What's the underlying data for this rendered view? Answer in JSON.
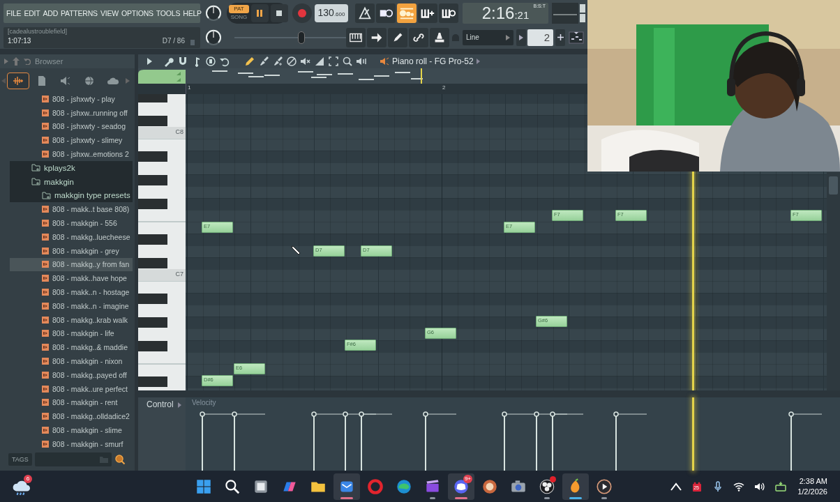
{
  "menu": [
    "FILE",
    "EDIT",
    "ADD",
    "PATTERNS",
    "VIEW",
    "OPTIONS",
    "TOOLS",
    "HELP"
  ],
  "transport": {
    "modes": [
      {
        "label": "PAT",
        "selected": true
      },
      {
        "label": "SONG",
        "selected": false
      }
    ],
    "playing": true,
    "tempo": "130",
    "tempo_fraction": ".600",
    "time": "2:16",
    "time_seconds": ":21",
    "time_format": "B:S:T"
  },
  "hint_bar": {
    "title": "[cadealustroublefield]",
    "time": "1:07:13",
    "note": "D7 / 86"
  },
  "pitch_slider": {
    "level": 0.6
  },
  "snap": {
    "value": "Line"
  },
  "step": {
    "value": "2"
  },
  "browser": {
    "title": "Browser",
    "tabs": [
      {
        "selected": true
      },
      {
        "selected": false
      },
      {
        "selected": false
      },
      {
        "selected": false
      },
      {
        "selected": false
      }
    ],
    "items": [
      {
        "kind": "preset",
        "label": "808 - jshxwty - play",
        "selected": false
      },
      {
        "kind": "preset",
        "label": "808 - jshxw..running off",
        "selected": false
      },
      {
        "kind": "preset",
        "label": "808 - jshxwty - seadog",
        "selected": false
      },
      {
        "kind": "preset",
        "label": "808 - jshxwty - slimey",
        "selected": false
      },
      {
        "kind": "preset",
        "label": "808 - jshxw..emotions 2",
        "selected": false
      },
      {
        "kind": "folder",
        "label": "kplays2k",
        "selected": false
      },
      {
        "kind": "folder",
        "label": "makkgin",
        "selected": false,
        "children": [
          {
            "kind": "folder",
            "label": "makkgin type presets",
            "selected": false,
            "children": [
              {
                "kind": "preset",
                "label": "808 - makk..t base 808)",
                "selected": false
              },
              {
                "kind": "preset",
                "label": "808 - makkgin - 556",
                "selected": false
              },
              {
                "kind": "preset",
                "label": "808 - makkg..luecheese",
                "selected": false
              },
              {
                "kind": "preset",
                "label": "808 - makkgin - grey",
                "selected": false
              },
              {
                "kind": "preset",
                "label": "808 - makkg..y from fan",
                "selected": true
              },
              {
                "kind": "preset",
                "label": "808 - makk..have hope",
                "selected": false
              },
              {
                "kind": "preset",
                "label": "808 - makk..n - hostage",
                "selected": false
              },
              {
                "kind": "preset",
                "label": "808 - makk..n - imagine",
                "selected": false
              },
              {
                "kind": "preset",
                "label": "808 - makkg..krab walk",
                "selected": false
              },
              {
                "kind": "preset",
                "label": "808 - makkgin - life",
                "selected": false
              },
              {
                "kind": "preset",
                "label": "808 - makkg..& maddie",
                "selected": false
              },
              {
                "kind": "preset",
                "label": "808 - makkgin - nixon",
                "selected": false
              },
              {
                "kind": "preset",
                "label": "808 - makkg..payed off",
                "selected": false
              },
              {
                "kind": "preset",
                "label": "808 - makk..ure perfect",
                "selected": false
              },
              {
                "kind": "preset",
                "label": "808 - makkgin - rent",
                "selected": false
              },
              {
                "kind": "preset",
                "label": "808 - makkg..olldadice2",
                "selected": false
              },
              {
                "kind": "preset",
                "label": "808 - makkgin - slime",
                "selected": false
              },
              {
                "kind": "preset",
                "label": "808 - makkgin - smurf",
                "selected": false
              }
            ]
          }
        ]
      }
    ],
    "tags_label": "TAGS"
  },
  "piano_roll": {
    "title": "Piano roll - FG Pro-52",
    "tools": [
      {
        "selected": true
      },
      {
        "selected": false
      },
      {
        "selected": false
      },
      {
        "selected": false
      },
      {
        "selected": false
      },
      {
        "selected": false
      },
      {
        "selected": false
      },
      {
        "selected": false
      },
      {
        "selected": false
      }
    ],
    "ruler": [
      "1",
      "2"
    ],
    "keys": [
      "C8",
      "C7"
    ],
    "notes": [
      {
        "label": "E7"
      },
      {
        "label": "D#6"
      },
      {
        "label": "E6"
      },
      {
        "label": "D7"
      },
      {
        "label": "F#6"
      },
      {
        "label": "D7"
      },
      {
        "label": "G6"
      },
      {
        "label": "E7"
      },
      {
        "label": "G#6"
      },
      {
        "label": "F7"
      },
      {
        "label": "F7"
      },
      {
        "label": "F7"
      }
    ],
    "control_label": "Control",
    "control_target": "Velocity"
  },
  "taskbar": {
    "apps": [
      {
        "kind": "weather",
        "selected": false,
        "running": false,
        "badge": "6"
      },
      {
        "kind": "start",
        "selected": false,
        "running": false
      },
      {
        "kind": "search",
        "selected": false,
        "running": false
      },
      {
        "kind": "files",
        "selected": false,
        "running": false
      },
      {
        "kind": "copilot",
        "selected": false,
        "running": false
      },
      {
        "kind": "explorer",
        "selected": false,
        "running": false
      },
      {
        "kind": "mail",
        "selected": true,
        "running": true
      },
      {
        "kind": "opera",
        "selected": false,
        "running": false
      },
      {
        "kind": "edge",
        "selected": false,
        "running": false
      },
      {
        "kind": "clapper",
        "selected": false,
        "running": true
      },
      {
        "kind": "discord",
        "selected": true,
        "running": true,
        "badge": "9+"
      },
      {
        "kind": "paint",
        "selected": false,
        "running": false
      },
      {
        "kind": "camera",
        "selected": false,
        "running": false
      },
      {
        "kind": "obs",
        "selected": false,
        "running": true,
        "alert": true
      },
      {
        "kind": "fl",
        "selected": true,
        "running": true
      },
      {
        "kind": "player",
        "selected": false,
        "running": true
      }
    ],
    "tray": [
      {
        "kind": "chevron"
      },
      {
        "kind": "calendar",
        "badge": "25"
      },
      {
        "kind": "mic"
      },
      {
        "kind": "wifi"
      },
      {
        "kind": "volume"
      },
      {
        "kind": "keyboard"
      }
    ],
    "clock": {
      "time": "2:38 AM",
      "date": "1/2/2026"
    }
  },
  "webcam": {
    "kind": "picture"
  }
}
